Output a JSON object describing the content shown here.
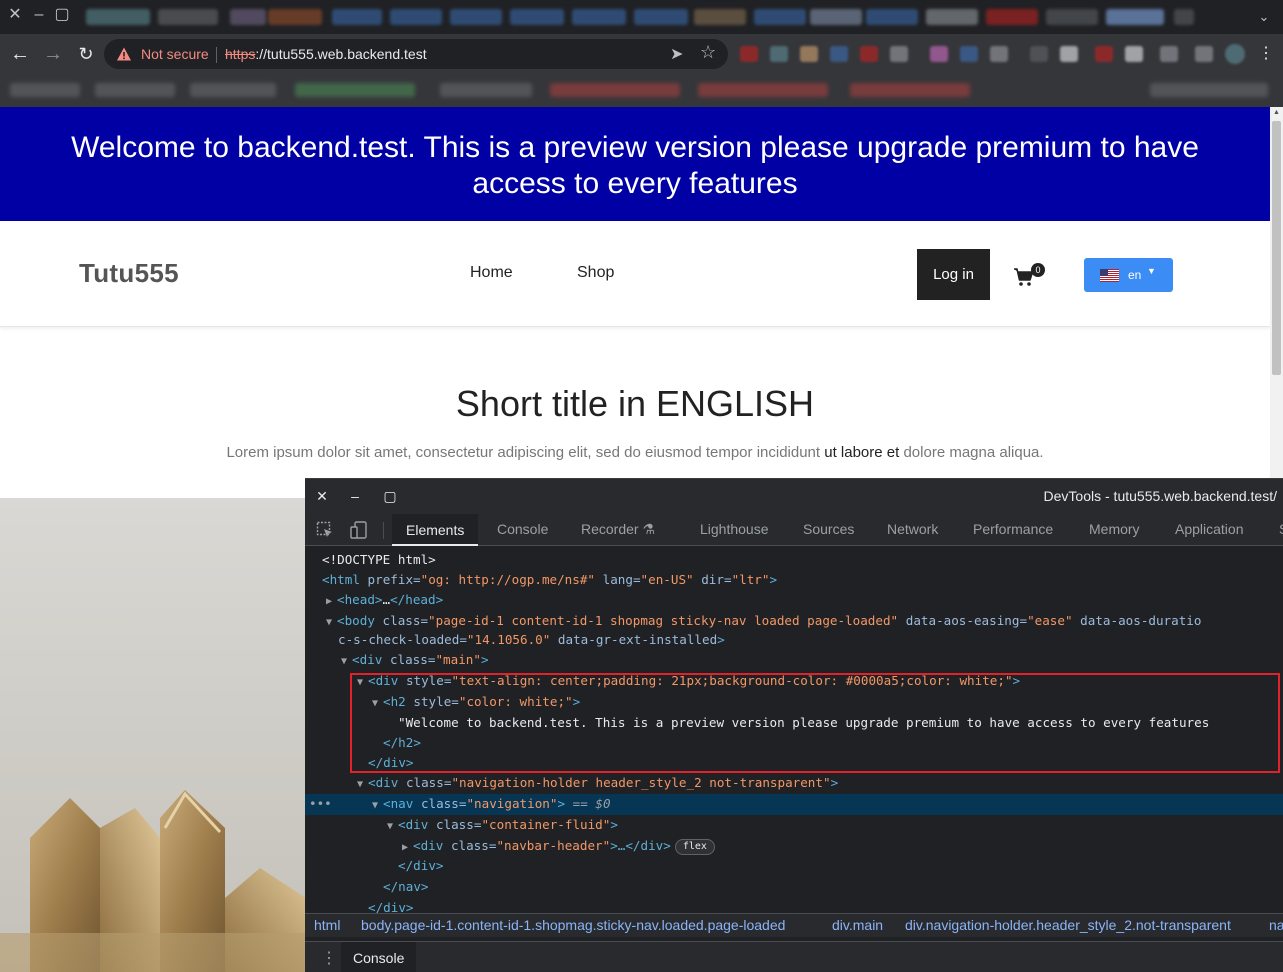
{
  "browser": {
    "security_label": "Not secure",
    "url_scheme": "https",
    "url_rest": "://tutu555.web.backend.test"
  },
  "page": {
    "banner_text": "Welcome to backend.test. This is a preview version please upgrade premium to have access to every features",
    "logo": "Tutu555",
    "nav": [
      "Home",
      "Shop"
    ],
    "login_label": "Log in",
    "cart_count": "0",
    "language": "en",
    "hero_title": "Short title in ENGLISH",
    "hero_sub_a": "Lorem ipsum dolor sit amet, consectetur adipiscing elit, sed do eiusmod tempor incididunt ",
    "hero_sub_b": "ut labore et",
    "hero_sub_c": " dolore magna aliqua."
  },
  "devtools": {
    "title": "DevTools - tutu555.web.backend.test/",
    "tabs": [
      "Elements",
      "Console",
      "Recorder",
      "Lighthouse",
      "Sources",
      "Network",
      "Performance",
      "Memory",
      "Application",
      "S"
    ],
    "dom": {
      "doctype": "<!DOCTYPE html>",
      "html_tag": "html",
      "html_prefix_attr": "prefix",
      "html_prefix_val": "\"og: http://ogp.me/ns#\"",
      "html_lang_attr": "lang",
      "html_lang_val": "\"en-US\"",
      "html_dir_attr": "dir",
      "html_dir_val": "\"ltr\"",
      "head_open": "<head>",
      "head_ellipsis": "…",
      "head_close": "</head>",
      "body_tag": "body",
      "body_class_attr": "class",
      "body_class_val": "\"page-id-1 content-id-1 shopmag sticky-nav loaded page-loaded\"",
      "body_aos_attr": "data-aos-easing",
      "body_aos_val": "\"ease\"",
      "body_aos_dur_attr": "data-aos-duratio",
      "body_check_attr": "c-s-check-loaded",
      "body_check_val": "\"14.1056.0\"",
      "body_ext_attr": "data-gr-ext-installed",
      "main_tag": "div",
      "main_class_attr": "class",
      "main_class_val": "\"main\"",
      "promo_tag": "div",
      "promo_style_attr": "style",
      "promo_style_val": "\"text-align: center;padding: 21px;background-color: #0000a5;color: white;\"",
      "h2_tag": "h2",
      "h2_style_attr": "style",
      "h2_style_val": "\"color: white;\"",
      "h2_text": "\"Welcome to backend.test. This is a preview version please upgrade premium to have access to every features",
      "h2_close": "</h2>",
      "div_close": "</div>",
      "navholder_tag": "div",
      "navholder_class_attr": "class",
      "navholder_class_val": "\"navigation-holder header_style_2 not-transparent\"",
      "nav_tag": "nav",
      "nav_class_attr": "class",
      "nav_class_val": "\"navigation\"",
      "nav_eq": "== $0",
      "container_tag": "div",
      "container_class_attr": "class",
      "container_class_val": "\"container-fluid\"",
      "navbar_tag": "div",
      "navbar_class_attr": "class",
      "navbar_class_val": "\"navbar-header\"",
      "navbar_rest": ">…</div>",
      "flex_badge": "flex",
      "nav_close": "</nav>",
      "div_close_partial": "</div>"
    },
    "breadcrumbs": [
      "html",
      "body.page-id-1.content-id-1.shopmag.sticky-nav.loaded.page-loaded",
      "div.main",
      "div.navigation-holder.header_style_2.not-transparent",
      "na"
    ],
    "drawer_tab": "Console"
  },
  "colors": {
    "banner_bg": "#0000a5",
    "lang_button": "#3b8df5",
    "security_warning": "#f28b82",
    "selection_row": "#073655",
    "highlight_box": "#e0222b"
  }
}
